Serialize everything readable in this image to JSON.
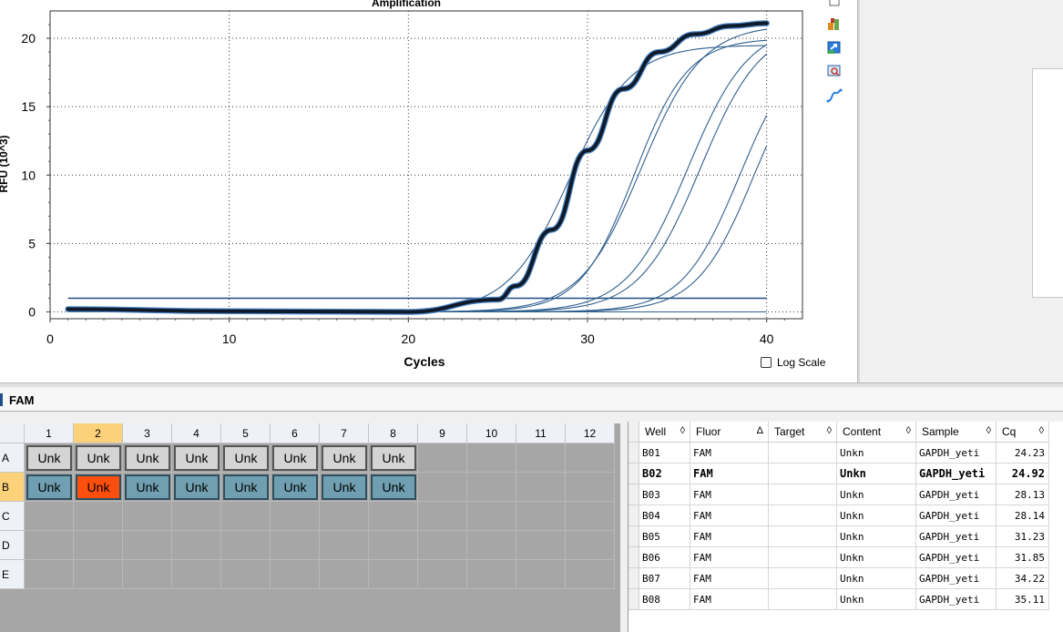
{
  "chart_data": {
    "type": "line",
    "title": "Amplification",
    "xlabel": "Cycles",
    "ylabel": "RFU (10^3)",
    "xlim": [
      0,
      42
    ],
    "ylim": [
      -0.5,
      22
    ],
    "xticks": [
      0,
      10,
      20,
      30,
      40
    ],
    "yticks": [
      0,
      5,
      10,
      15,
      20
    ],
    "grid": true,
    "threshold": 1.0,
    "baseline_value": 0.0,
    "highlight_color": "#0f1a2a",
    "highlight_outline": "#4d86c6",
    "series_color": "#2f5f8f",
    "threshold_color": "#1f4e80",
    "series": [
      {
        "name": "B02",
        "highlighted": true,
        "plateau": 21.5,
        "midpoint": 29.6,
        "slope": 1.9,
        "values_at_cycles": {
          "1": 0.2,
          "10": 0.05,
          "20": 0.0,
          "25": 0.9,
          "26": 1.9,
          "28": 6.0,
          "30": 11.8,
          "32": 16.3,
          "34": 19.0,
          "36": 20.3,
          "38": 20.9,
          "40": 21.1
        }
      },
      {
        "name": "B01",
        "highlighted": false,
        "plateau": 19.5,
        "midpoint": 29.0,
        "slope": 1.7
      },
      {
        "name": "B03",
        "highlighted": false,
        "plateau": 20.0,
        "midpoint": 32.6,
        "slope": 1.5
      },
      {
        "name": "B04",
        "highlighted": false,
        "plateau": 21.0,
        "midpoint": 33.0,
        "slope": 1.7
      },
      {
        "name": "B05",
        "highlighted": false,
        "plateau": 21.0,
        "midpoint": 35.6,
        "slope": 1.7
      },
      {
        "name": "B06",
        "highlighted": false,
        "plateau": 21.0,
        "midpoint": 36.3,
        "slope": 1.7
      },
      {
        "name": "B07",
        "highlighted": false,
        "plateau": 20.0,
        "midpoint": 38.5,
        "slope": 1.6
      },
      {
        "name": "B08",
        "highlighted": false,
        "plateau": 20.0,
        "midpoint": 39.3,
        "slope": 1.6
      }
    ]
  },
  "log_scale": {
    "label": "Log Scale",
    "checked": false
  },
  "toolbar_icons": [
    "copy-icon",
    "tools-icon",
    "export-icon",
    "zoom-icon",
    "curve-icon"
  ],
  "fluor_tab": {
    "label": "FAM",
    "color": "#1f4e8c"
  },
  "plate": {
    "columns": [
      "1",
      "2",
      "3",
      "4",
      "5",
      "6",
      "7",
      "8",
      "9",
      "10",
      "11",
      "12"
    ],
    "rows": [
      "A",
      "B",
      "C",
      "D",
      "E"
    ],
    "selected_column": "2",
    "selected_row": "B",
    "wells": [
      {
        "row": "A",
        "col": 1,
        "label": "Unk",
        "state": "grey"
      },
      {
        "row": "A",
        "col": 2,
        "label": "Unk",
        "state": "grey"
      },
      {
        "row": "A",
        "col": 3,
        "label": "Unk",
        "state": "grey"
      },
      {
        "row": "A",
        "col": 4,
        "label": "Unk",
        "state": "grey"
      },
      {
        "row": "A",
        "col": 5,
        "label": "Unk",
        "state": "grey"
      },
      {
        "row": "A",
        "col": 6,
        "label": "Unk",
        "state": "grey"
      },
      {
        "row": "A",
        "col": 7,
        "label": "Unk",
        "state": "grey"
      },
      {
        "row": "A",
        "col": 8,
        "label": "Unk",
        "state": "grey"
      },
      {
        "row": "B",
        "col": 1,
        "label": "Unk",
        "state": "teal"
      },
      {
        "row": "B",
        "col": 2,
        "label": "Unk",
        "state": "selected"
      },
      {
        "row": "B",
        "col": 3,
        "label": "Unk",
        "state": "teal"
      },
      {
        "row": "B",
        "col": 4,
        "label": "Unk",
        "state": "teal"
      },
      {
        "row": "B",
        "col": 5,
        "label": "Unk",
        "state": "teal"
      },
      {
        "row": "B",
        "col": 6,
        "label": "Unk",
        "state": "teal"
      },
      {
        "row": "B",
        "col": 7,
        "label": "Unk",
        "state": "teal"
      },
      {
        "row": "B",
        "col": 8,
        "label": "Unk",
        "state": "teal"
      }
    ]
  },
  "table": {
    "headers": [
      {
        "label": "Well",
        "sort": "◊"
      },
      {
        "label": "Fluor",
        "sort": "Δ"
      },
      {
        "label": "Target",
        "sort": "◊"
      },
      {
        "label": "Content",
        "sort": "◊"
      },
      {
        "label": "Sample",
        "sort": "◊"
      },
      {
        "label": "Cq",
        "sort": "◊"
      }
    ],
    "rows": [
      {
        "well": "B01",
        "fluor": "FAM",
        "target": "",
        "content": "Unkn",
        "sample": "GAPDH_yeti",
        "cq": "24.23",
        "bold": false
      },
      {
        "well": "B02",
        "fluor": "FAM",
        "target": "",
        "content": "Unkn",
        "sample": "GAPDH_yeti",
        "cq": "24.92",
        "bold": true
      },
      {
        "well": "B03",
        "fluor": "FAM",
        "target": "",
        "content": "Unkn",
        "sample": "GAPDH_yeti",
        "cq": "28.13",
        "bold": false
      },
      {
        "well": "B04",
        "fluor": "FAM",
        "target": "",
        "content": "Unkn",
        "sample": "GAPDH_yeti",
        "cq": "28.14",
        "bold": false
      },
      {
        "well": "B05",
        "fluor": "FAM",
        "target": "",
        "content": "Unkn",
        "sample": "GAPDH_yeti",
        "cq": "31.23",
        "bold": false
      },
      {
        "well": "B06",
        "fluor": "FAM",
        "target": "",
        "content": "Unkn",
        "sample": "GAPDH_yeti",
        "cq": "31.85",
        "bold": false
      },
      {
        "well": "B07",
        "fluor": "FAM",
        "target": "",
        "content": "Unkn",
        "sample": "GAPDH_yeti",
        "cq": "34.22",
        "bold": false
      },
      {
        "well": "B08",
        "fluor": "FAM",
        "target": "",
        "content": "Unkn",
        "sample": "GAPDH_yeti",
        "cq": "35.11",
        "bold": false
      }
    ]
  }
}
